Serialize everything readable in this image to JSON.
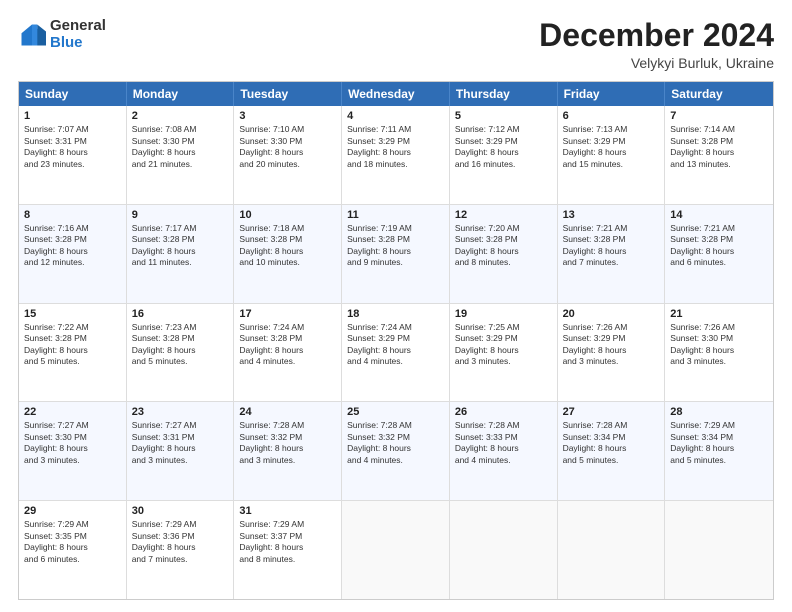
{
  "logo": {
    "general": "General",
    "blue": "Blue"
  },
  "title": "December 2024",
  "location": "Velykyi Burluk, Ukraine",
  "header_days": [
    "Sunday",
    "Monday",
    "Tuesday",
    "Wednesday",
    "Thursday",
    "Friday",
    "Saturday"
  ],
  "weeks": [
    [
      {
        "day": "1",
        "lines": [
          "Sunrise: 7:07 AM",
          "Sunset: 3:31 PM",
          "Daylight: 8 hours",
          "and 23 minutes."
        ]
      },
      {
        "day": "2",
        "lines": [
          "Sunrise: 7:08 AM",
          "Sunset: 3:30 PM",
          "Daylight: 8 hours",
          "and 21 minutes."
        ]
      },
      {
        "day": "3",
        "lines": [
          "Sunrise: 7:10 AM",
          "Sunset: 3:30 PM",
          "Daylight: 8 hours",
          "and 20 minutes."
        ]
      },
      {
        "day": "4",
        "lines": [
          "Sunrise: 7:11 AM",
          "Sunset: 3:29 PM",
          "Daylight: 8 hours",
          "and 18 minutes."
        ]
      },
      {
        "day": "5",
        "lines": [
          "Sunrise: 7:12 AM",
          "Sunset: 3:29 PM",
          "Daylight: 8 hours",
          "and 16 minutes."
        ]
      },
      {
        "day": "6",
        "lines": [
          "Sunrise: 7:13 AM",
          "Sunset: 3:29 PM",
          "Daylight: 8 hours",
          "and 15 minutes."
        ]
      },
      {
        "day": "7",
        "lines": [
          "Sunrise: 7:14 AM",
          "Sunset: 3:28 PM",
          "Daylight: 8 hours",
          "and 13 minutes."
        ]
      }
    ],
    [
      {
        "day": "8",
        "lines": [
          "Sunrise: 7:16 AM",
          "Sunset: 3:28 PM",
          "Daylight: 8 hours",
          "and 12 minutes."
        ]
      },
      {
        "day": "9",
        "lines": [
          "Sunrise: 7:17 AM",
          "Sunset: 3:28 PM",
          "Daylight: 8 hours",
          "and 11 minutes."
        ]
      },
      {
        "day": "10",
        "lines": [
          "Sunrise: 7:18 AM",
          "Sunset: 3:28 PM",
          "Daylight: 8 hours",
          "and 10 minutes."
        ]
      },
      {
        "day": "11",
        "lines": [
          "Sunrise: 7:19 AM",
          "Sunset: 3:28 PM",
          "Daylight: 8 hours",
          "and 9 minutes."
        ]
      },
      {
        "day": "12",
        "lines": [
          "Sunrise: 7:20 AM",
          "Sunset: 3:28 PM",
          "Daylight: 8 hours",
          "and 8 minutes."
        ]
      },
      {
        "day": "13",
        "lines": [
          "Sunrise: 7:21 AM",
          "Sunset: 3:28 PM",
          "Daylight: 8 hours",
          "and 7 minutes."
        ]
      },
      {
        "day": "14",
        "lines": [
          "Sunrise: 7:21 AM",
          "Sunset: 3:28 PM",
          "Daylight: 8 hours",
          "and 6 minutes."
        ]
      }
    ],
    [
      {
        "day": "15",
        "lines": [
          "Sunrise: 7:22 AM",
          "Sunset: 3:28 PM",
          "Daylight: 8 hours",
          "and 5 minutes."
        ]
      },
      {
        "day": "16",
        "lines": [
          "Sunrise: 7:23 AM",
          "Sunset: 3:28 PM",
          "Daylight: 8 hours",
          "and 5 minutes."
        ]
      },
      {
        "day": "17",
        "lines": [
          "Sunrise: 7:24 AM",
          "Sunset: 3:28 PM",
          "Daylight: 8 hours",
          "and 4 minutes."
        ]
      },
      {
        "day": "18",
        "lines": [
          "Sunrise: 7:24 AM",
          "Sunset: 3:29 PM",
          "Daylight: 8 hours",
          "and 4 minutes."
        ]
      },
      {
        "day": "19",
        "lines": [
          "Sunrise: 7:25 AM",
          "Sunset: 3:29 PM",
          "Daylight: 8 hours",
          "and 3 minutes."
        ]
      },
      {
        "day": "20",
        "lines": [
          "Sunrise: 7:26 AM",
          "Sunset: 3:29 PM",
          "Daylight: 8 hours",
          "and 3 minutes."
        ]
      },
      {
        "day": "21",
        "lines": [
          "Sunrise: 7:26 AM",
          "Sunset: 3:30 PM",
          "Daylight: 8 hours",
          "and 3 minutes."
        ]
      }
    ],
    [
      {
        "day": "22",
        "lines": [
          "Sunrise: 7:27 AM",
          "Sunset: 3:30 PM",
          "Daylight: 8 hours",
          "and 3 minutes."
        ]
      },
      {
        "day": "23",
        "lines": [
          "Sunrise: 7:27 AM",
          "Sunset: 3:31 PM",
          "Daylight: 8 hours",
          "and 3 minutes."
        ]
      },
      {
        "day": "24",
        "lines": [
          "Sunrise: 7:28 AM",
          "Sunset: 3:32 PM",
          "Daylight: 8 hours",
          "and 3 minutes."
        ]
      },
      {
        "day": "25",
        "lines": [
          "Sunrise: 7:28 AM",
          "Sunset: 3:32 PM",
          "Daylight: 8 hours",
          "and 4 minutes."
        ]
      },
      {
        "day": "26",
        "lines": [
          "Sunrise: 7:28 AM",
          "Sunset: 3:33 PM",
          "Daylight: 8 hours",
          "and 4 minutes."
        ]
      },
      {
        "day": "27",
        "lines": [
          "Sunrise: 7:28 AM",
          "Sunset: 3:34 PM",
          "Daylight: 8 hours",
          "and 5 minutes."
        ]
      },
      {
        "day": "28",
        "lines": [
          "Sunrise: 7:29 AM",
          "Sunset: 3:34 PM",
          "Daylight: 8 hours",
          "and 5 minutes."
        ]
      }
    ],
    [
      {
        "day": "29",
        "lines": [
          "Sunrise: 7:29 AM",
          "Sunset: 3:35 PM",
          "Daylight: 8 hours",
          "and 6 minutes."
        ]
      },
      {
        "day": "30",
        "lines": [
          "Sunrise: 7:29 AM",
          "Sunset: 3:36 PM",
          "Daylight: 8 hours",
          "and 7 minutes."
        ]
      },
      {
        "day": "31",
        "lines": [
          "Sunrise: 7:29 AM",
          "Sunset: 3:37 PM",
          "Daylight: 8 hours",
          "and 8 minutes."
        ]
      },
      null,
      null,
      null,
      null
    ]
  ]
}
